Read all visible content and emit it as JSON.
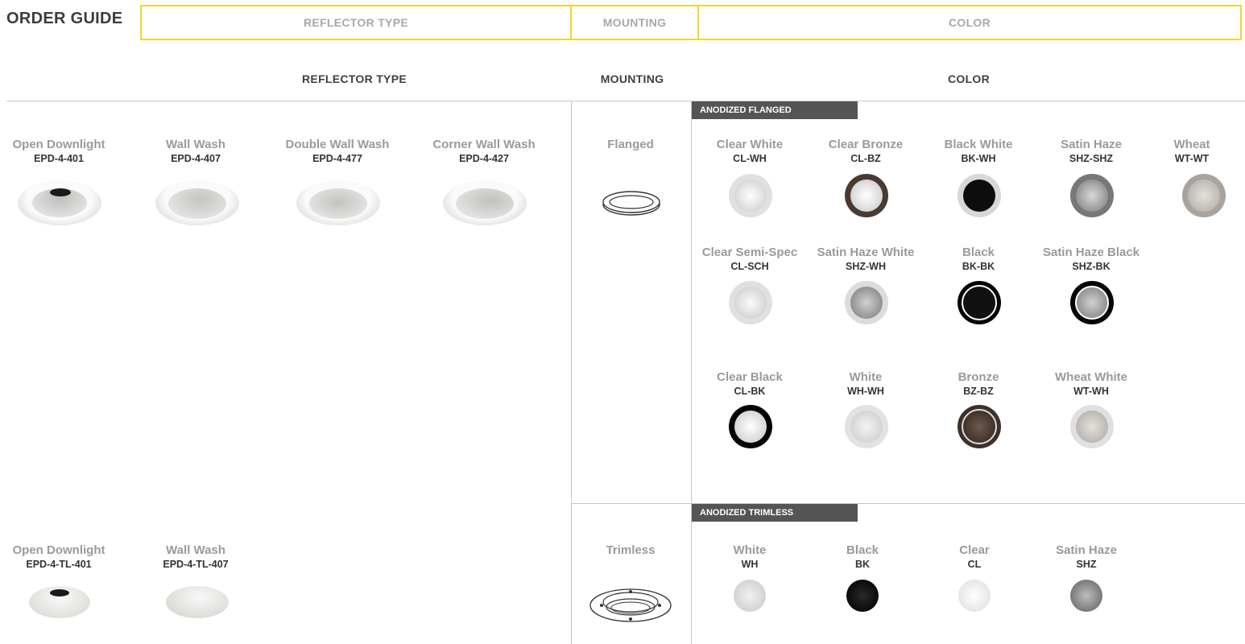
{
  "header": {
    "title": "ORDER GUIDE",
    "tabs": {
      "reflector": "REFLECTOR TYPE",
      "mounting": "MOUNTING",
      "color": "COLOR"
    }
  },
  "columns": {
    "reflector": "REFLECTOR TYPE",
    "mounting": "MOUNTING",
    "color": "COLOR"
  },
  "flanged": {
    "reflectors": [
      {
        "name": "Open Downlight",
        "code": "EPD-4-401",
        "image": "open-downlight-reflector"
      },
      {
        "name": "Wall Wash",
        "code": "EPD-4-407",
        "image": "wall-wash-reflector"
      },
      {
        "name": "Double Wall Wash",
        "code": "EPD-4-477",
        "image": "double-wall-wash-reflector"
      },
      {
        "name": "Corner Wall Wash",
        "code": "EPD-4-427",
        "image": "corner-wall-wash-reflector"
      }
    ],
    "mounting": {
      "name": "Flanged",
      "icon": "flanged-ring-icon"
    },
    "section_label": "ANODIZED FLANGED",
    "colors": [
      {
        "name": "Clear White",
        "code": "CL-WH",
        "outer": "#e0e0e0",
        "inner": "#f2f2f2"
      },
      {
        "name": "Clear Bronze",
        "code": "CL-BZ",
        "outer": "#4a3a30",
        "inner": "#f0f0f0"
      },
      {
        "name": "Black White",
        "code": "BK-WH",
        "outer": "#d8d8d8",
        "inner": "#111111"
      },
      {
        "name": "Satin Haze",
        "code": "SHZ-SHZ",
        "outer": "#777777",
        "inner": "#aaaaaa"
      },
      {
        "name": "Wheat",
        "code": "WT-WT",
        "outer": "#a8a39e",
        "inner": "#cfcac5"
      },
      {
        "name": "Clear Semi-Spec",
        "code": "CL-SCH",
        "outer": "#e0e0e0",
        "inner": "#f0f0f0"
      },
      {
        "name": "Satin Haze White",
        "code": "SHZ-WH",
        "outer": "#dcdcdc",
        "inner": "#909090"
      },
      {
        "name": "Black",
        "code": "BK-BK",
        "outer": "#0a0a0a",
        "inner": "#111111"
      },
      {
        "name": "Satin Haze Black",
        "code": "SHZ-BK",
        "outer": "#0a0a0a",
        "inner": "#9a9a9a"
      },
      {
        "name": "Clear Black",
        "code": "CL-BK",
        "outer": "#0a0a0a",
        "inner": "#f0f0f0"
      },
      {
        "name": "White",
        "code": "WH-WH",
        "outer": "#e2e2e2",
        "inner": "#e8e8e8"
      },
      {
        "name": "Bronze",
        "code": "BZ-BZ",
        "outer": "#4a3a30",
        "inner": "#3a2c24"
      },
      {
        "name": "Wheat White",
        "code": "WT-WH",
        "outer": "#e0e0e0",
        "inner": "#c8c3be"
      }
    ]
  },
  "trimless": {
    "reflectors": [
      {
        "name": "Open Downlight",
        "code": "EPD-4-TL-401",
        "image": "open-downlight-trimless-reflector"
      },
      {
        "name": "Wall Wash",
        "code": "EPD-4-TL-407",
        "image": "wall-wash-trimless-reflector"
      }
    ],
    "mounting": {
      "name": "Trimless",
      "icon": "trimless-plate-icon"
    },
    "section_label": "ANODIZED TRIMLESS",
    "colors": [
      {
        "name": "White",
        "code": "WH",
        "fill": "#d9d9d9"
      },
      {
        "name": "Black",
        "code": "BK",
        "fill": "#0d0d0d"
      },
      {
        "name": "Clear",
        "code": "CL",
        "fill": "#efefef"
      },
      {
        "name": "Satin Haze",
        "code": "SHZ",
        "fill": "#8a8a8a"
      }
    ]
  }
}
